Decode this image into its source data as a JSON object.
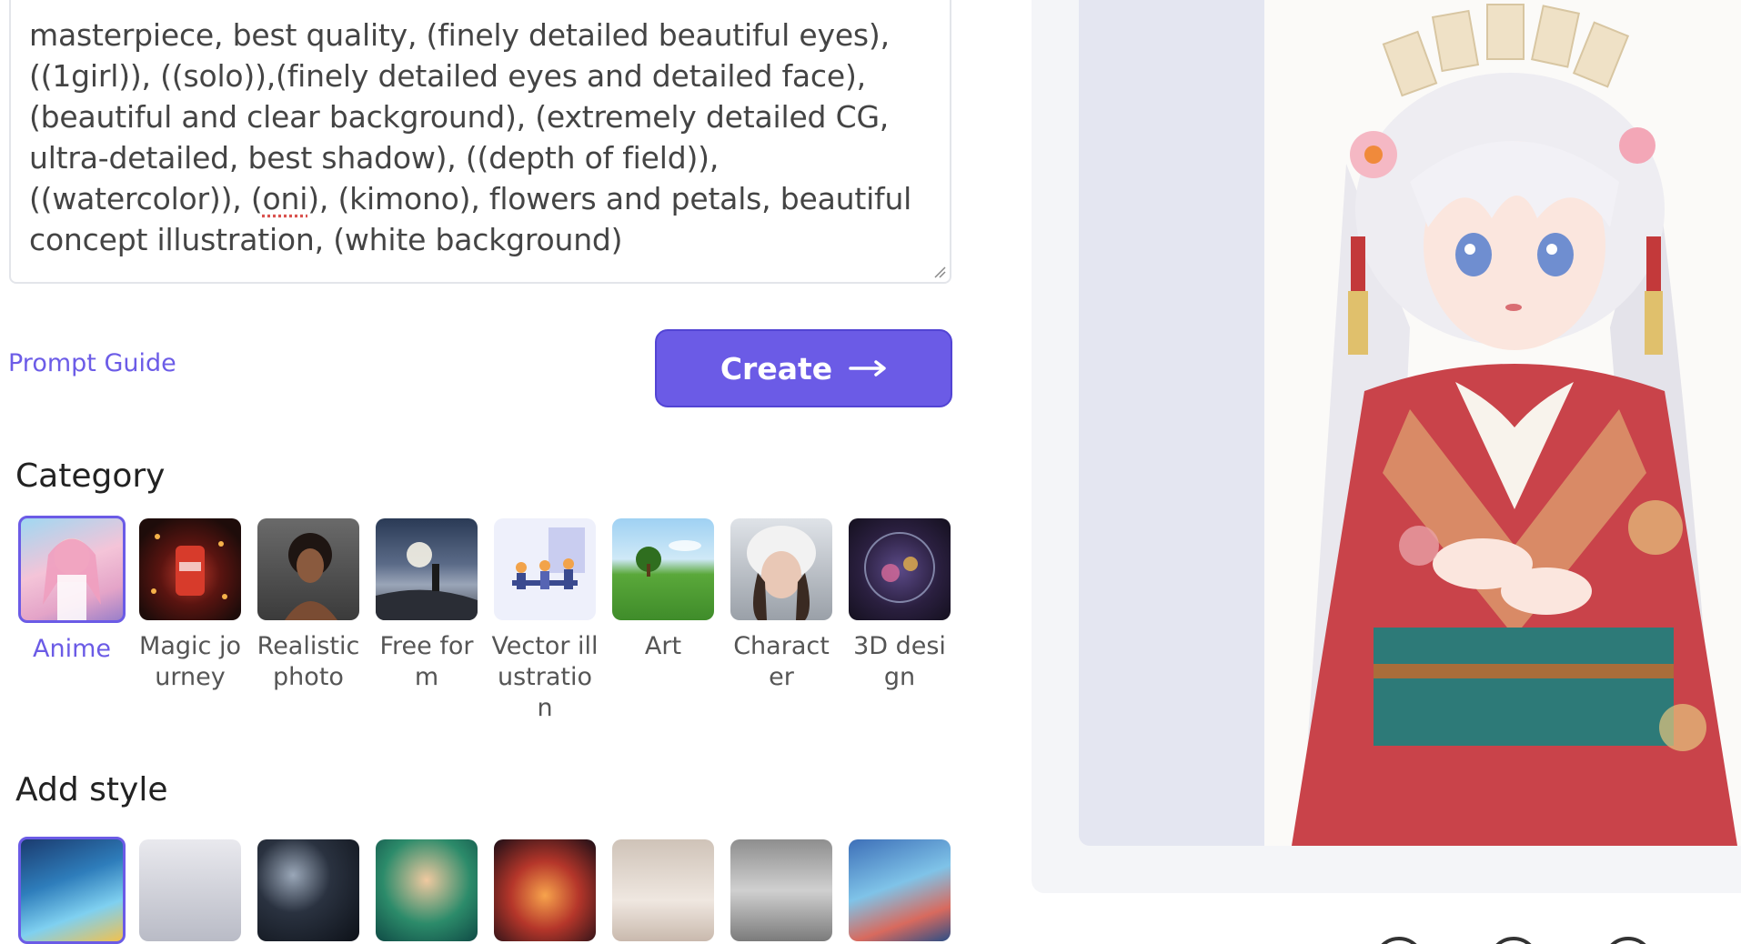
{
  "prompt": {
    "text_before": "masterpiece, best quality, (finely detailed beautiful eyes), ((1girl)), ((solo)),(finely detailed eyes and detailed face), (beautiful and clear background), (extremely detailed CG, ultra-detailed, best shadow), ((depth of field)), ((watercolor)), (",
    "text_spell": "oni",
    "text_after": "), (kimono), flowers and petals, beautiful concept illustration, (white background)"
  },
  "prompt_guide_label": "Prompt Guide",
  "create_label": "Create",
  "category": {
    "title": "Category",
    "items": [
      {
        "label": "Anime",
        "selected": true,
        "icon": "anime-thumb"
      },
      {
        "label": "Magic journey",
        "selected": false,
        "icon": "magic-journey-thumb"
      },
      {
        "label": "Realistic photo",
        "selected": false,
        "icon": "realistic-photo-thumb"
      },
      {
        "label": "Free form",
        "selected": false,
        "icon": "free-form-thumb"
      },
      {
        "label": "Vector illustration",
        "selected": false,
        "icon": "vector-illustration-thumb"
      },
      {
        "label": "Art",
        "selected": false,
        "icon": "art-thumb"
      },
      {
        "label": "Character",
        "selected": false,
        "icon": "character-thumb"
      },
      {
        "label": "3D design",
        "selected": false,
        "icon": "3d-design-thumb"
      }
    ]
  },
  "add_style": {
    "title": "Add style",
    "items": [
      {
        "selected": true
      },
      {
        "selected": false
      },
      {
        "selected": false
      },
      {
        "selected": false
      },
      {
        "selected": false
      },
      {
        "selected": false
      },
      {
        "selected": false
      },
      {
        "selected": false
      }
    ]
  },
  "colors": {
    "accent": "#6b5be6",
    "link": "#6c5ce7",
    "preview_bg": "#f4f5f8",
    "preview_inner": "#e4e6f1"
  }
}
